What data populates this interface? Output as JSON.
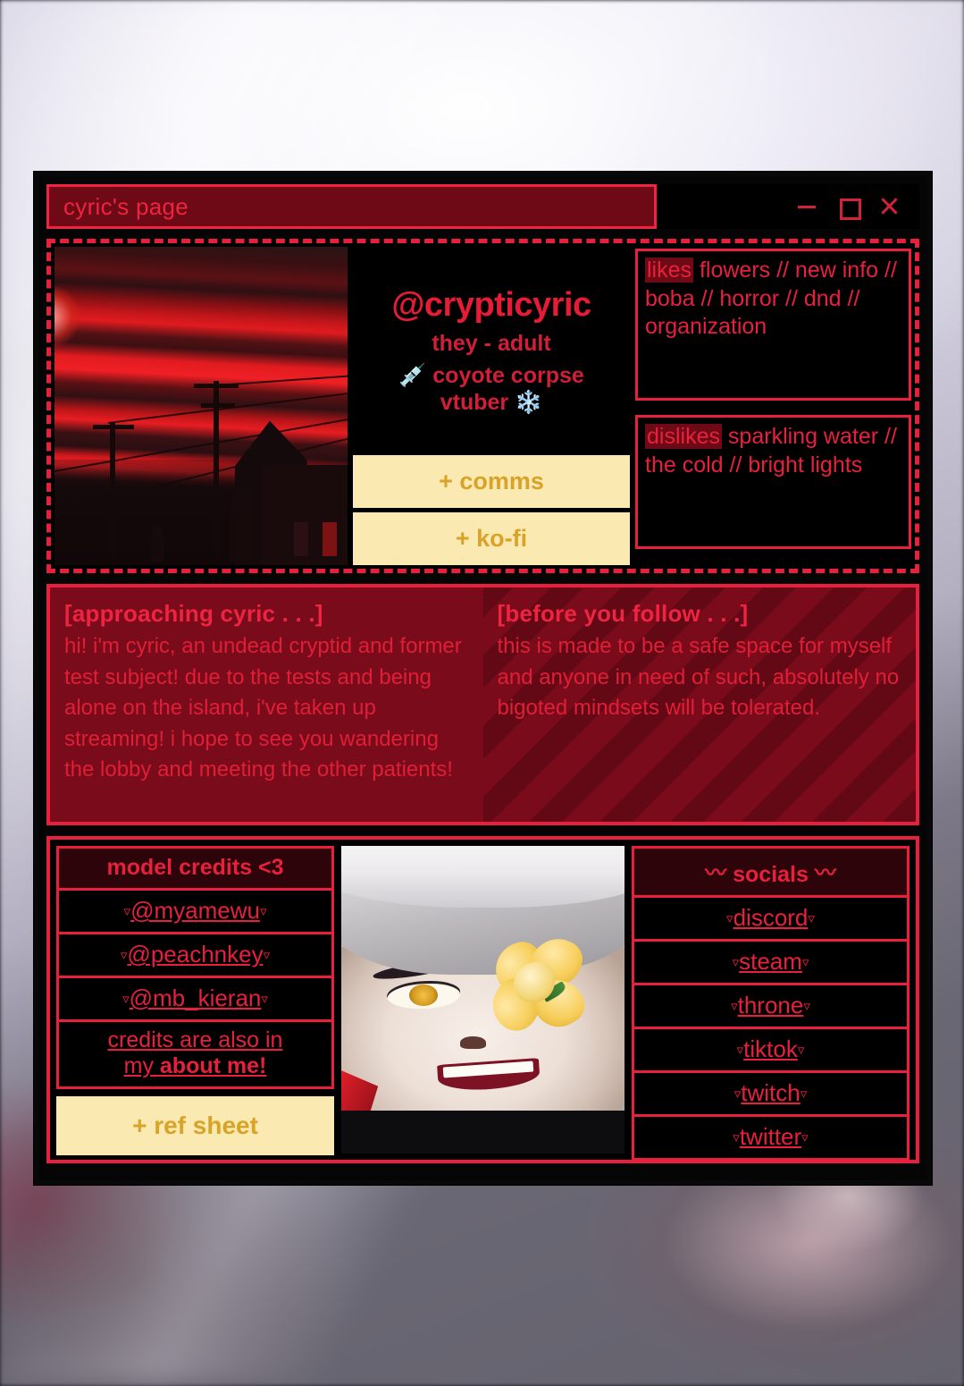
{
  "window": {
    "title": "cyric's page",
    "controls": [
      {
        "name": "minimize",
        "glyph": "—"
      },
      {
        "name": "maximize",
        "glyph": "□"
      },
      {
        "name": "close",
        "glyph": "✕"
      }
    ]
  },
  "profile": {
    "handle": "@crypticyric",
    "pronouns": "they - adult",
    "descriptor": "💉 coyote corpse vtuber ❄️",
    "descriptor_line1": "💉 coyote corpse",
    "descriptor_line2": "vtuber ❄️",
    "buttons": [
      {
        "label": "+ comms"
      },
      {
        "label": "+ ko-fi"
      }
    ],
    "photo_alt": "red sunset sky over power lines and buildings"
  },
  "traits": {
    "likes": {
      "key": "likes",
      "value": " flowers // new info // boba // horror // dnd // organization"
    },
    "dislikes": {
      "key": "dislikes",
      "value": " sparkling water // the cold // bright lights"
    }
  },
  "about": {
    "left": {
      "heading": "[approaching cyric . . .]",
      "body": "hi! i'm cyric, an undead cryptid and former test subject! due to the tests and being alone on the island, i've taken up streaming! i hope to see you wandering the lobby and meeting the other patients!"
    },
    "right": {
      "heading": "[before you follow . . .]",
      "body": "this is made to be a safe space for myself and anyone in need of such, absolutely no bigoted mindsets will be tolerated."
    }
  },
  "credits": {
    "heading": "model credits <3",
    "items": [
      {
        "label": "@myamewu",
        "left_mark": "▿",
        "right_mark": "▿"
      },
      {
        "label": "@peachnkey",
        "left_mark": "▿",
        "right_mark": "▿"
      },
      {
        "label": "@mb_kieran",
        "left_mark": "▿",
        "right_mark": "▿"
      }
    ],
    "note_line1": "credits are also in",
    "note_line2_plain": "my ",
    "note_line2_bold": "about me!",
    "ref_button": "+ ref sheet"
  },
  "socials": {
    "heading": "socials",
    "heading_mark": "〰",
    "items": [
      {
        "label": "discord",
        "left_mark": "▿",
        "right_mark": "▿"
      },
      {
        "label": "steam",
        "left_mark": "▿",
        "right_mark": "▿"
      },
      {
        "label": "throne",
        "left_mark": "▿",
        "right_mark": "▿"
      },
      {
        "label": "tiktok",
        "left_mark": "▿",
        "right_mark": "▿"
      },
      {
        "label": "twitch",
        "left_mark": "▿",
        "right_mark": "▿"
      },
      {
        "label": "twitter",
        "left_mark": "▿",
        "right_mark": "▿"
      }
    ]
  },
  "portrait": {
    "alt": "white-haired character with yellow flower over one eye, smiling"
  },
  "colors": {
    "accent_red": "#e8203d",
    "deep_red": "#7a0b1a",
    "dark_red": "#6d0a16",
    "cream": "#fae9b0",
    "gold": "#d9a32a",
    "black": "#000000"
  }
}
